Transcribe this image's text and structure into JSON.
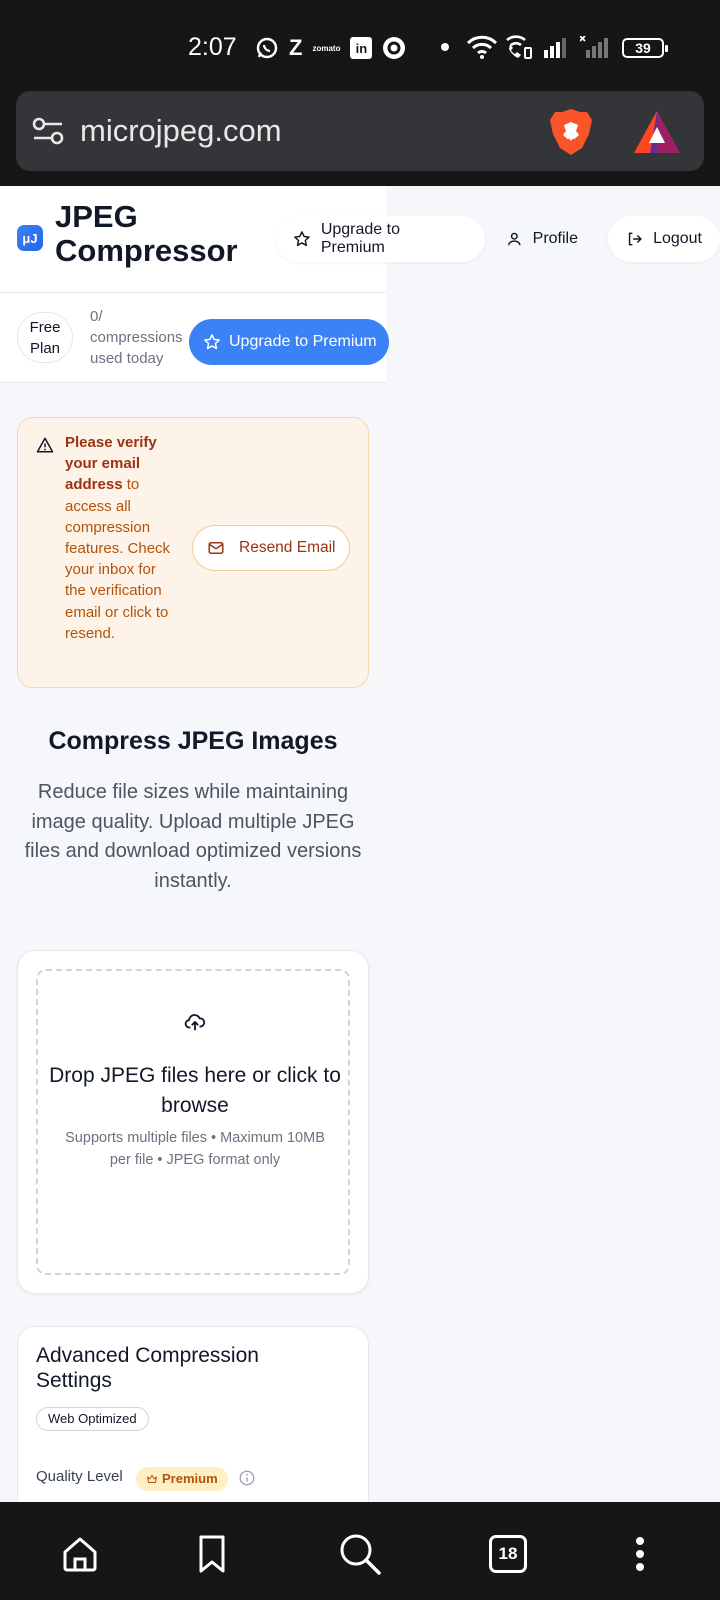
{
  "status_bar": {
    "time": "2:07",
    "battery": "39",
    "app_icons": [
      "whatsapp-icon",
      "zepto-icon",
      "zomato-icon",
      "linkedin-icon",
      "circle-app-icon"
    ],
    "z_label": "Z",
    "zomato_label": "zomato",
    "linkedin_label": "in"
  },
  "browser": {
    "url": "microjpeg.com",
    "tab_count": "18"
  },
  "header": {
    "logo_text": "μJ",
    "brand": "JPEG Compressor",
    "nav_upgrade": "Upgrade to Premium",
    "nav_profile": "Profile",
    "nav_logout": "Logout"
  },
  "plan": {
    "badge": "Free Plan",
    "usage": "0/ compressions used today",
    "upgrade": "Upgrade to Premium"
  },
  "alert": {
    "bold_text": "Please verify your email address",
    "text": " to access all compression features. Check your inbox for the verification email or click to resend.",
    "resend_label": "Resend Email"
  },
  "hero": {
    "title": "Compress JPEG Images",
    "subtitle": "Reduce file sizes while maintaining image quality. Upload multiple JPEG files and download optimized versions instantly."
  },
  "upload": {
    "title": "Drop JPEG files here or click to browse",
    "subtitle": "Supports multiple files • Maximum 10MB per file • JPEG format only"
  },
  "settings": {
    "title": "Advanced Compression Settings",
    "preset_badge": "Web Optimized",
    "quality_label": "Quality Level",
    "premium_badge": "Premium"
  },
  "colors": {
    "accent": "#3b82f6",
    "alert_bg": "#fef3e8",
    "alert_text": "#b45309",
    "premium_bg": "#fdf0c4"
  }
}
